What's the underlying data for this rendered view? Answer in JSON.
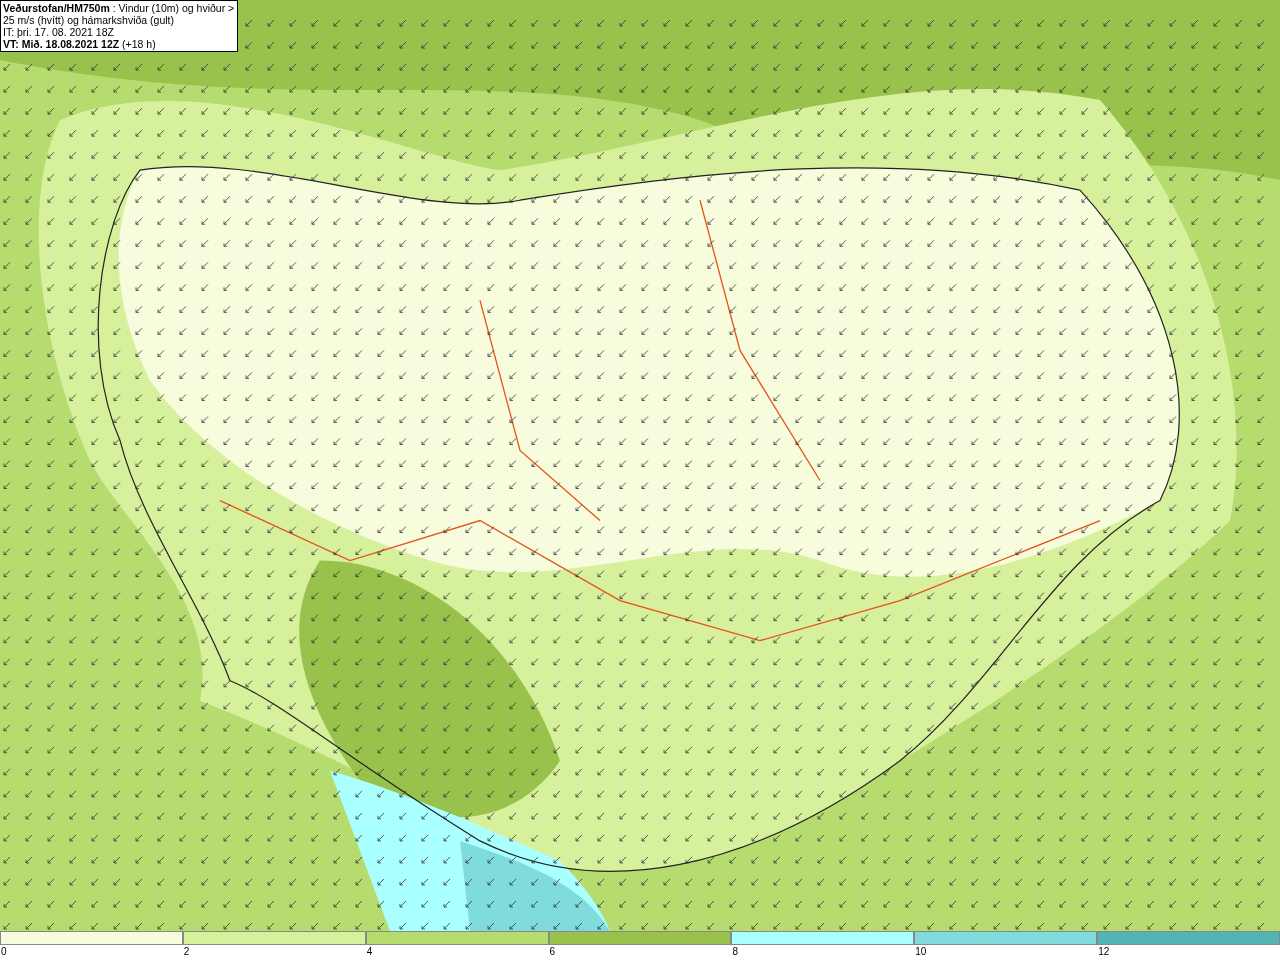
{
  "map": {
    "title": "**Veðurstofan/HM750m** : Vindur (10m) og hviður > 25 m/s (hvítt) og hámarkshviða (gult)",
    "issue_time": "IT: þri. 17. 08. 2021 18Z",
    "valid_time": "**VT: Mið. 18.08.2021 12Z** (+18 h)"
  },
  "legend": [
    {
      "label": "0",
      "color": "#f6fcdc"
    },
    {
      "label": "2",
      "color": "#d6f09c"
    },
    {
      "label": "4",
      "color": "#b6dc70"
    },
    {
      "label": "6",
      "color": "#98c24c"
    },
    {
      "label": "8",
      "color": "#aaffff"
    },
    {
      "label": "10",
      "color": "#80dcdc"
    },
    {
      "label": "12",
      "color": "#52b4b4"
    }
  ]
}
